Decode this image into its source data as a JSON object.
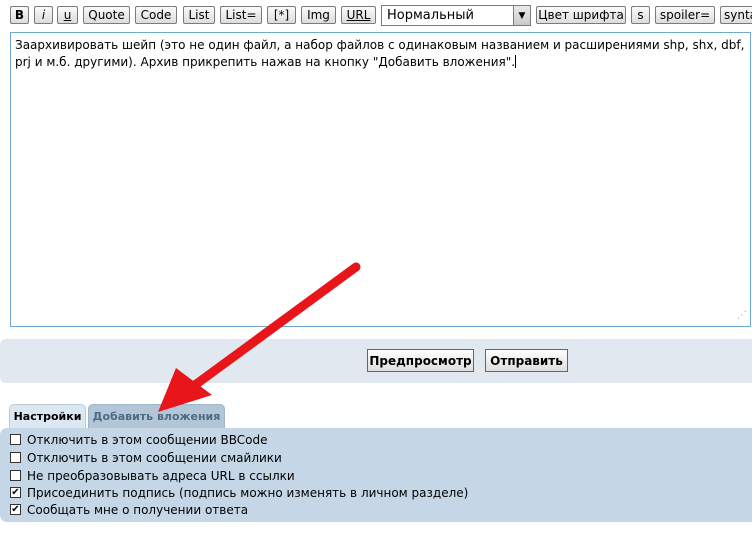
{
  "toolbar": {
    "bold": "B",
    "italic": "i",
    "underline": "u",
    "quote": "Quote",
    "code": "Code",
    "list": "List",
    "list_eq": "List=",
    "list_item": "[*]",
    "img": "Img",
    "url": "URL",
    "font_size_value": "Нормальный",
    "font_color": "Цвет шрифта",
    "strike": "s",
    "spoiler": "spoiler=",
    "syntax": "synta"
  },
  "editor": {
    "text": "Заархивировать шейп (это не один файл, а набор файлов с одинаковым названием и расширениями shp, shx, dbf, prj и м.б. другими). Архив прикрепить нажав на кнопку \"Добавить вложения\"."
  },
  "actions": {
    "preview": "Предпросмотр",
    "submit": "Отправить"
  },
  "tabs": {
    "settings": "Настройки",
    "attachments": "Добавить вложения"
  },
  "options": [
    {
      "label": "Отключить в этом сообщении BBCode",
      "checked": false
    },
    {
      "label": "Отключить в этом сообщении смайлики",
      "checked": false
    },
    {
      "label": "Не преобразовывать адреса URL в ссылки",
      "checked": false
    },
    {
      "label": "Присоединить подпись (подпись можно изменять в личном разделе)",
      "checked": true
    },
    {
      "label": "Сообщать мне о получении ответа",
      "checked": true
    }
  ],
  "colors": {
    "arrow": "#e8161b",
    "options_panel": "#c5d7e7",
    "submit_panel": "#e1e8ef",
    "editor_border": "#6fa9cf"
  },
  "icons": {
    "dropdown": "chevron-down-icon",
    "arrow": "red-arrow-annotation",
    "checkmark": "checkmark-icon"
  }
}
